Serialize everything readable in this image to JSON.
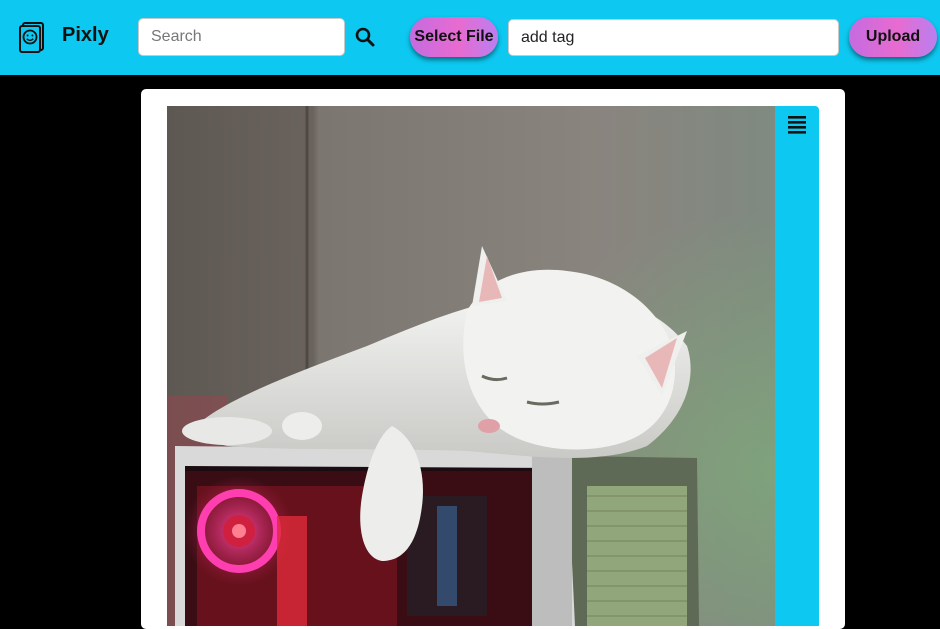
{
  "navbar": {
    "brand": "Pixly",
    "logo_icon": "photo-album-smiley-icon",
    "search": {
      "placeholder": "Search",
      "value": "",
      "icon": "search-icon"
    },
    "select_file_label": "Select File",
    "tag_input": {
      "value": "add tag"
    },
    "upload_label": "Upload",
    "color": "#0dc8f0"
  },
  "main": {
    "photo": {
      "subject": "white cat sleeping on a PC case with red/pink RGB fan lighting"
    },
    "side_panel": {
      "icon": "menu-icon",
      "color": "#0dc8f0"
    }
  }
}
